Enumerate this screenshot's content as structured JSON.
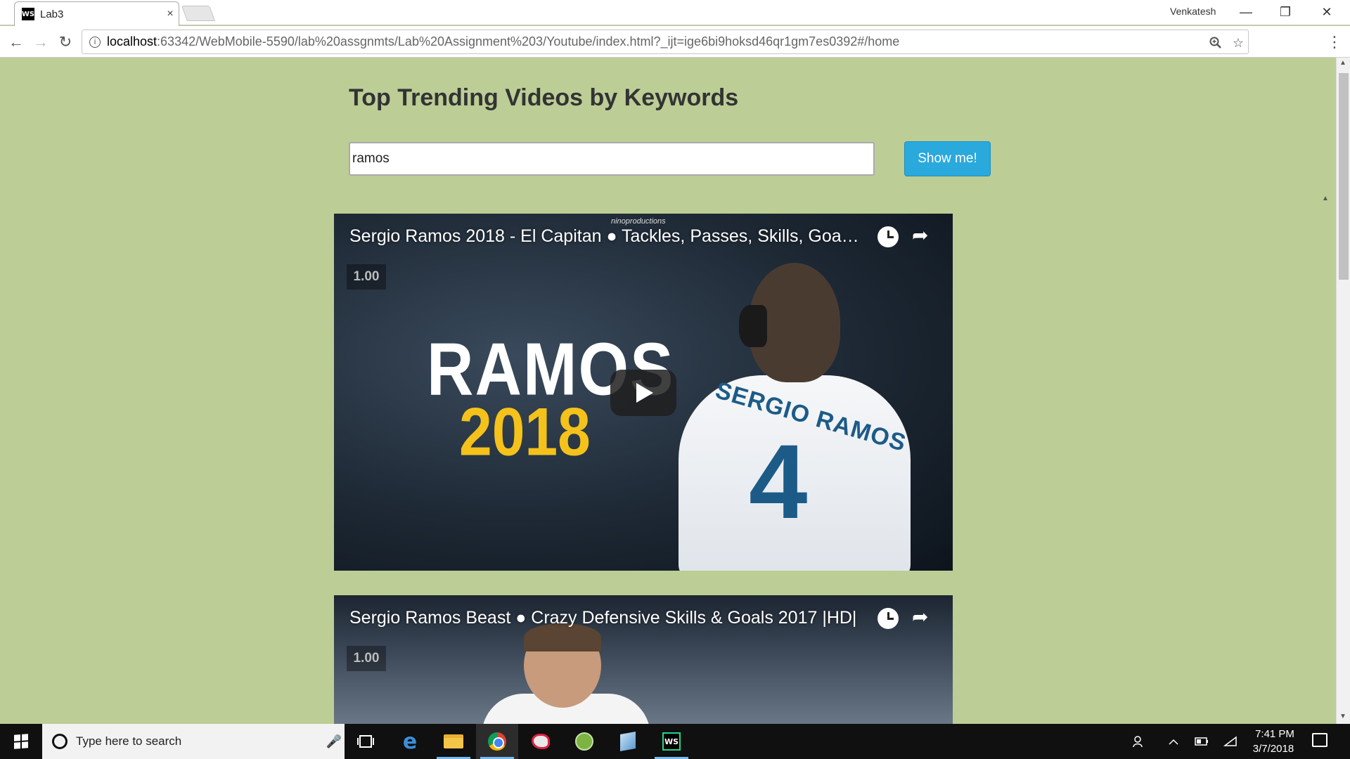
{
  "browser": {
    "tab": {
      "favicon": "WS",
      "title": "Lab3",
      "close": "×"
    },
    "profile_name": "Venkatesh",
    "window_controls": {
      "minimize": "—",
      "restore": "❐",
      "close": "✕"
    },
    "nav": {
      "back": "←",
      "forward": "→",
      "reload": "↻",
      "menu": "⋮"
    },
    "url": {
      "host": "localhost",
      "rest": ":63342/WebMobile-5590/lab%20assgnmts/Lab%20Assignment%203/Youtube/index.html?_ijt=ige6bi9hoksd46qr1gm7es0392#/home"
    },
    "omnibox_icons": {
      "zoom": "zoom-icon",
      "bookmark": "star-icon"
    }
  },
  "page": {
    "title": "Top Trending Videos by Keywords",
    "search": {
      "value": "ramos",
      "placeholder": ""
    },
    "show_button": "Show me!",
    "videos": [
      {
        "title": "Sergio Ramos 2018 - El Capitan ● Tackles, Passes, Skills, Goals ● ...",
        "channel_watermark": "ninoproductions",
        "speed": "1.00",
        "thumb_text_main": "RAMOS",
        "thumb_text_year": "2018",
        "jersey_name": "SERGIO RAMOS",
        "jersey_number": "4"
      },
      {
        "title": "Sergio Ramos Beast ● Crazy Defensive Skills & Goals 2017 |HD|",
        "speed": "1.00"
      }
    ]
  },
  "taskbar": {
    "search_placeholder": "Type here to search",
    "apps": [
      "task-view",
      "edge",
      "file-explorer",
      "chrome",
      "paint",
      "android-studio",
      "virtualbox",
      "webstorm"
    ],
    "clock": {
      "time": "7:41 PM",
      "date": "3/7/2018"
    }
  },
  "colors": {
    "page_background": "#bccd96",
    "button_background": "#2aa9dd",
    "title_text": "#333333"
  }
}
